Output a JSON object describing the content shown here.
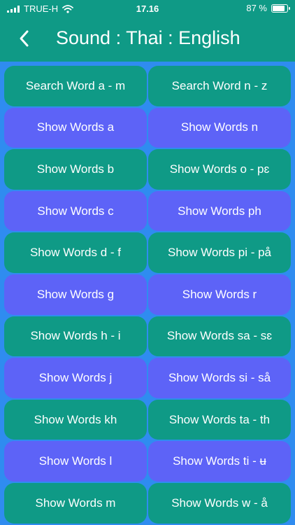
{
  "status": {
    "carrier": "TRUE-H",
    "time": "17.16",
    "battery": "87 %",
    "battery_level": 0.87
  },
  "header": {
    "title": "Sound : Thai : English",
    "back_icon": "chevron-left-icon"
  },
  "colors": {
    "green": "#0f9a86",
    "blue": "#5d63f7",
    "background": "#2f8cf0"
  },
  "buttons": [
    {
      "label": "Search Word a - m",
      "color": "green"
    },
    {
      "label": "Search Word n - z",
      "color": "green"
    },
    {
      "label": "Show Words a",
      "color": "blue"
    },
    {
      "label": "Show Words n",
      "color": "blue"
    },
    {
      "label": "Show Words b",
      "color": "green"
    },
    {
      "label": "Show Words o - pɛ",
      "color": "green"
    },
    {
      "label": "Show Words c",
      "color": "blue"
    },
    {
      "label": "Show Words ph",
      "color": "blue"
    },
    {
      "label": "Show Words d - f",
      "color": "green"
    },
    {
      "label": "Show Words pi - på",
      "color": "green"
    },
    {
      "label": "Show Words g",
      "color": "blue"
    },
    {
      "label": "Show Words r",
      "color": "blue"
    },
    {
      "label": "Show Words h - i",
      "color": "green"
    },
    {
      "label": "Show Words sa - sɛ",
      "color": "green"
    },
    {
      "label": "Show Words j",
      "color": "blue"
    },
    {
      "label": "Show Words si - så",
      "color": "blue"
    },
    {
      "label": "Show Words kh",
      "color": "green"
    },
    {
      "label": "Show Words ta - th",
      "color": "green"
    },
    {
      "label": "Show Words l",
      "color": "blue"
    },
    {
      "label": "Show Words ti - ʉ",
      "color": "blue"
    },
    {
      "label": "Show Words m",
      "color": "green"
    },
    {
      "label": "Show Words w - å",
      "color": "green"
    }
  ]
}
